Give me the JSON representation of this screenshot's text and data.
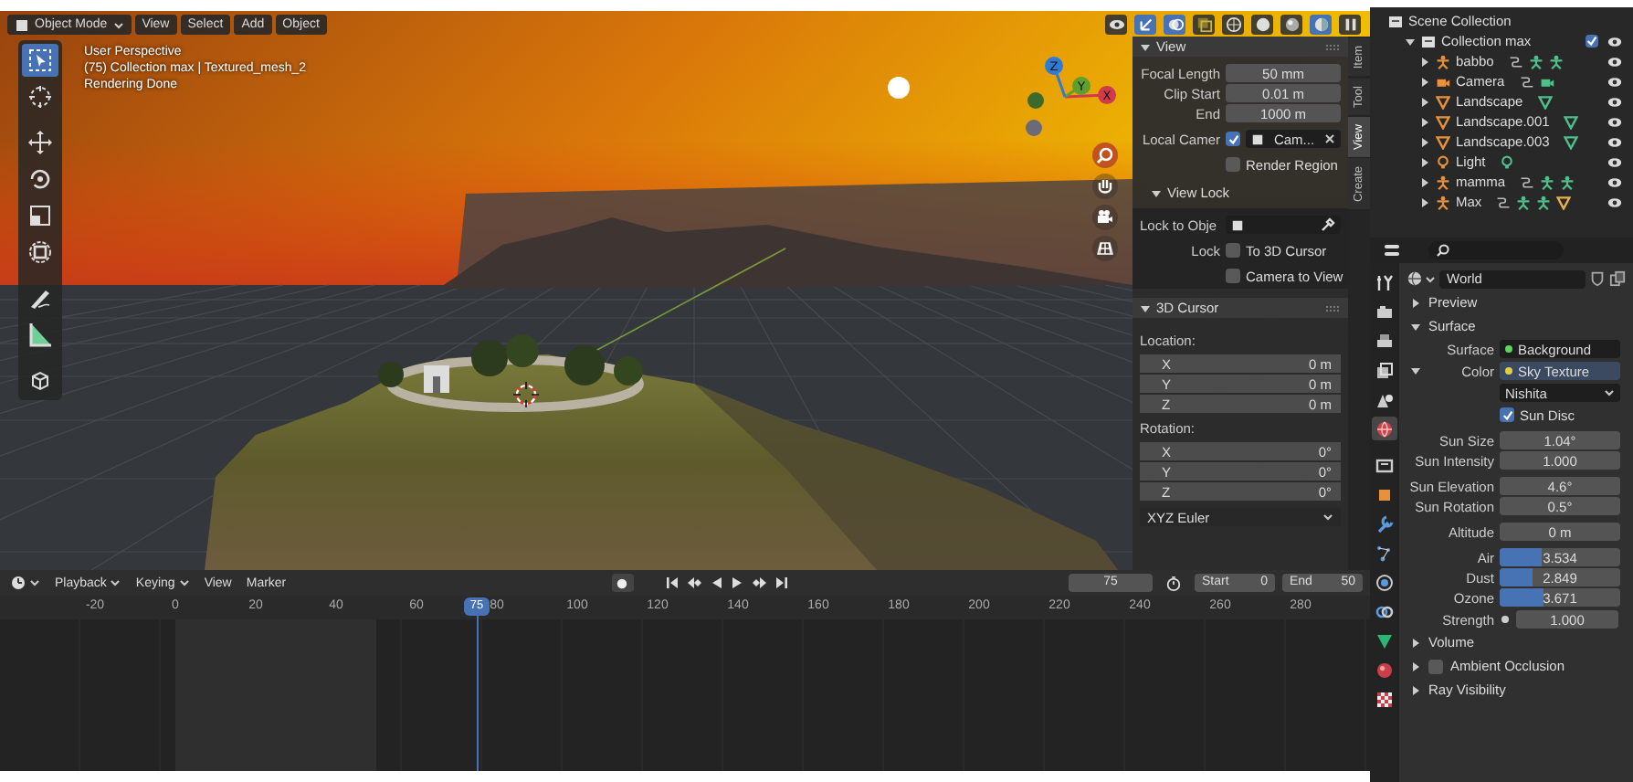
{
  "viewport": {
    "header": {
      "mode": "Object Mode",
      "menus": [
        "View",
        "Select",
        "Add",
        "Object"
      ],
      "toggles": [
        {
          "kind": "visibility",
          "selected": false
        },
        {
          "kind": "gizmos",
          "selected": true
        },
        {
          "kind": "overlays",
          "selected": true
        },
        {
          "kind": "xray",
          "selected": false
        },
        {
          "kind": "wireframe",
          "selected": false
        },
        {
          "kind": "solid",
          "selected": false
        },
        {
          "kind": "material",
          "selected": false
        },
        {
          "kind": "rendered",
          "selected": true
        },
        {
          "kind": "pause",
          "selected": false
        }
      ]
    },
    "info": [
      "User Perspective",
      "(75) Collection max | Textured_mesh_2",
      "Rendering Done"
    ],
    "toolbar": [
      {
        "kind": "select-box",
        "selected": true
      },
      {
        "kind": "cursor",
        "selected": false
      },
      {
        "kind": "move",
        "selected": false
      },
      {
        "kind": "rotate",
        "selected": false
      },
      {
        "kind": "scale",
        "selected": false
      },
      {
        "kind": "transform",
        "selected": false
      },
      {
        "kind": "annotate",
        "selected": false
      },
      {
        "kind": "measure",
        "selected": false
      },
      {
        "kind": "add-cube",
        "selected": false
      }
    ],
    "gizmo": [
      {
        "label": "Z",
        "color": "#2e7bd6"
      },
      {
        "label": "Y",
        "color": "#5f9e2f"
      },
      {
        "label": "X",
        "color": "#d13a4c"
      }
    ],
    "navigation": [
      {
        "kind": "zoom"
      },
      {
        "kind": "pan"
      },
      {
        "kind": "camera"
      },
      {
        "kind": "ortho"
      }
    ]
  },
  "sidebar": {
    "tabs": [
      {
        "label": "Item",
        "selected": false
      },
      {
        "label": "Tool",
        "selected": false
      },
      {
        "label": "View",
        "selected": true
      },
      {
        "label": "Create",
        "selected": false
      }
    ],
    "view": {
      "title": "View",
      "expanded": true,
      "fields": [
        {
          "label": "Focal Length",
          "value": "50 mm"
        },
        {
          "label": "Clip Start",
          "value": "0.01 m"
        },
        {
          "label": "End",
          "value": "1000 m"
        }
      ],
      "local_camera": {
        "label": "Local Camer",
        "checked": true,
        "value": "Cam..."
      },
      "render_region": {
        "label": "Render Region",
        "checked": false
      },
      "view_lock": {
        "title": "View Lock",
        "expanded": true,
        "lock_object_label": "Lock to Obje",
        "lock_label": "Lock",
        "options": [
          {
            "label": "To 3D Cursor",
            "checked": false
          },
          {
            "label": "Camera to View",
            "checked": false
          }
        ]
      }
    },
    "cursor": {
      "title": "3D Cursor",
      "expanded": true,
      "location_label": "Location:",
      "location": [
        {
          "axis": "X",
          "value": "0 m"
        },
        {
          "axis": "Y",
          "value": "0 m"
        },
        {
          "axis": "Z",
          "value": "0 m"
        }
      ],
      "rotation_label": "Rotation:",
      "rotation": [
        {
          "axis": "X",
          "value": "0°"
        },
        {
          "axis": "Y",
          "value": "0°"
        },
        {
          "axis": "Z",
          "value": "0°"
        }
      ],
      "mode": "XYZ Euler"
    }
  },
  "outliner": {
    "title": "Scene Collection",
    "collection": {
      "name": "Collection max",
      "expanded": true,
      "checked": true,
      "children": [
        {
          "name": "babbo",
          "kind": "armature",
          "expanded": false,
          "extras": [
            {
              "kind": "constraint"
            },
            {
              "kind": "pose"
            },
            {
              "kind": "armature"
            }
          ]
        },
        {
          "name": "Camera",
          "kind": "camera",
          "expanded": false,
          "extras": [
            {
              "kind": "constraint"
            },
            {
              "kind": "camera"
            }
          ]
        },
        {
          "name": "Landscape",
          "kind": "mesh",
          "expanded": false,
          "extras": [
            {
              "kind": "mesh"
            }
          ]
        },
        {
          "name": "Landscape.001",
          "kind": "mesh",
          "expanded": false,
          "extras": [
            {
              "kind": "mesh"
            }
          ]
        },
        {
          "name": "Landscape.003",
          "kind": "mesh",
          "expanded": false,
          "extras": [
            {
              "kind": "mesh"
            }
          ]
        },
        {
          "name": "Light",
          "kind": "light",
          "expanded": false,
          "extras": [
            {
              "kind": "light"
            }
          ]
        },
        {
          "name": "mamma",
          "kind": "armature",
          "expanded": false,
          "extras": [
            {
              "kind": "constraint"
            },
            {
              "kind": "pose"
            },
            {
              "kind": "armature"
            }
          ]
        },
        {
          "name": "Max",
          "kind": "armature",
          "expanded": false,
          "extras": [
            {
              "kind": "constraint"
            },
            {
              "kind": "pose"
            },
            {
              "kind": "armature"
            },
            {
              "kind": "shape"
            }
          ]
        }
      ]
    }
  },
  "properties": {
    "tabs": [
      {
        "kind": "tool",
        "selected": false
      },
      {
        "kind": "render",
        "selected": false
      },
      {
        "kind": "output",
        "selected": false
      },
      {
        "kind": "view-layer",
        "selected": false
      },
      {
        "kind": "scene",
        "selected": false
      },
      {
        "kind": "world",
        "selected": true
      },
      {
        "kind": "collection",
        "selected": false
      },
      {
        "kind": "object",
        "selected": false
      },
      {
        "kind": "modifiers",
        "selected": false
      },
      {
        "kind": "particles",
        "selected": false
      },
      {
        "kind": "physics",
        "selected": false
      },
      {
        "kind": "constraints",
        "selected": false
      },
      {
        "kind": "data",
        "selected": false
      },
      {
        "kind": "material",
        "selected": false
      },
      {
        "kind": "texture",
        "selected": false
      }
    ],
    "world_name": "World",
    "preview": {
      "title": "Preview",
      "expanded": false
    },
    "surface": {
      "title": "Surface",
      "expanded": true,
      "surface_label": "Surface",
      "shader": "Background",
      "color_label": "Color",
      "texture": "Sky Texture",
      "sky_type": "Nishita",
      "sun_disc": {
        "label": "Sun Disc",
        "checked": true
      },
      "groups": [
        {
          "params": [
            {
              "label": "Sun Size",
              "value": "1.04°"
            },
            {
              "label": "Sun Intensity",
              "value": "1.000"
            }
          ]
        },
        {
          "params": [
            {
              "label": "Sun Elevation",
              "value": "4.6°"
            },
            {
              "label": "Sun Rotation",
              "value": "0.5°"
            }
          ]
        },
        {
          "params": [
            {
              "label": "Altitude",
              "value": "0 m"
            }
          ]
        },
        {
          "params": [
            {
              "label": "Air",
              "value": "3.534",
              "level": 0.35
            },
            {
              "label": "Dust",
              "value": "2.849",
              "level": 0.28
            },
            {
              "label": "Ozone",
              "value": "3.671",
              "level": 0.36
            }
          ]
        }
      ],
      "strength": {
        "label": "Strength",
        "value": "1.000"
      }
    },
    "sections": [
      {
        "title": "Volume",
        "kind": "plain",
        "expanded": false
      },
      {
        "title": "Ambient Occlusion",
        "kind": "checkbox",
        "checked": false,
        "expanded": false
      },
      {
        "title": "Ray Visibility",
        "kind": "plain",
        "expanded": false
      }
    ]
  },
  "timeline": {
    "menus": [
      {
        "label": "Playback",
        "dropdown": true
      },
      {
        "label": "Keying",
        "dropdown": true
      },
      {
        "label": "View",
        "dropdown": false
      },
      {
        "label": "Marker",
        "dropdown": false
      }
    ],
    "transport": [
      {
        "kind": "jump-start"
      },
      {
        "kind": "prev-key"
      },
      {
        "kind": "play-reverse"
      },
      {
        "kind": "play"
      },
      {
        "kind": "next-key"
      },
      {
        "kind": "jump-end"
      }
    ],
    "current_frame": "75",
    "start_label": "Start",
    "start": "0",
    "end_label": "End",
    "end": "50",
    "ticks": [
      "-20",
      "0",
      "20",
      "40",
      "60",
      "80",
      "100",
      "120",
      "140",
      "160",
      "180",
      "200",
      "220",
      "240",
      "260",
      "280"
    ],
    "playhead": "75"
  }
}
